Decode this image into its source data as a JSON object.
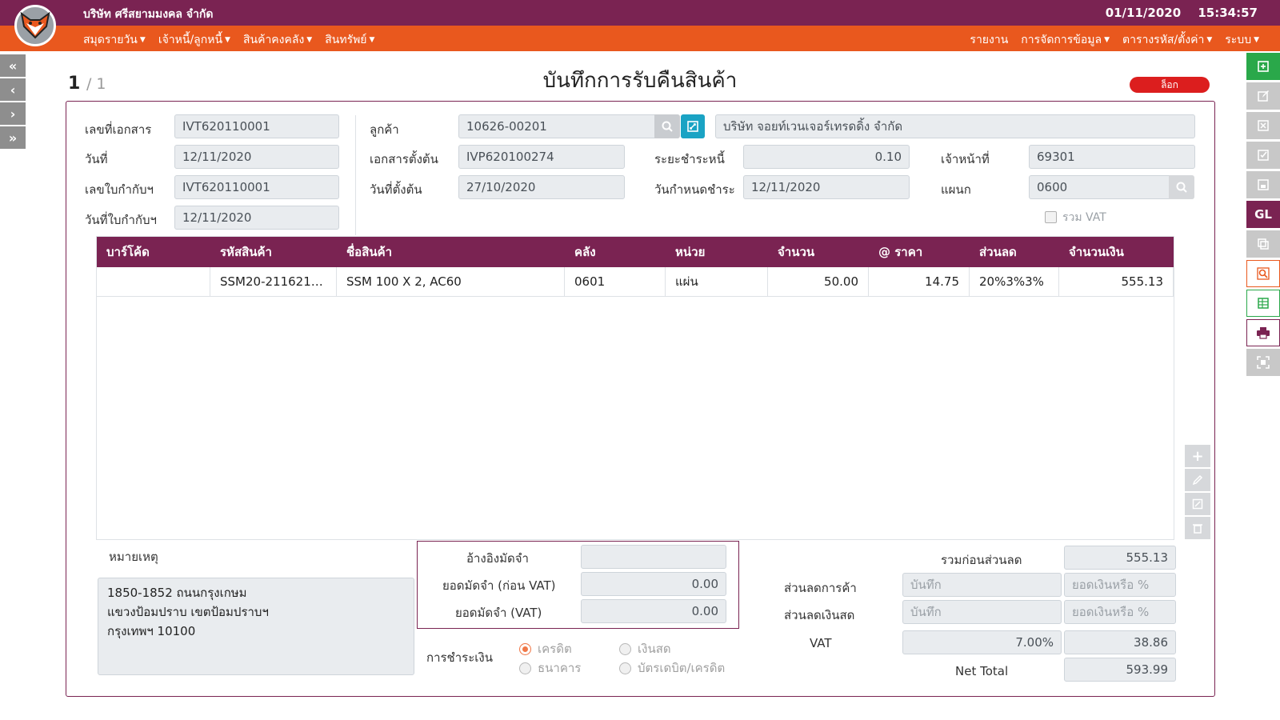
{
  "header": {
    "company": "บริษัท ศรีสยามมงคล จำกัด",
    "date": "01/11/2020",
    "time": "15:34:57"
  },
  "menu": {
    "left": [
      "สมุดรายวัน",
      "เจ้าหนี้/ลูกหนี้",
      "สินค้าคงคลัง",
      "สินทรัพย์"
    ],
    "right_report": "รายงาน",
    "right": [
      "การจัดการข้อมูล",
      "ตารางรหัส/ตั้งค่า",
      "ระบบ"
    ]
  },
  "pager": {
    "current": "1",
    "total": "/ 1"
  },
  "page_title": "บันทึกการรับคืนสินค้า",
  "status_badge": "ล็อก",
  "form": {
    "doc_no_label": "เลขที่เอกสาร",
    "doc_no": "IVT620110001",
    "date_label": "วันที่",
    "date": "12/11/2020",
    "tax_inv_label": "เลขใบกำกับฯ",
    "tax_inv": "IVT620110001",
    "tax_inv_date_label": "วันที่ใบกำกับฯ",
    "tax_inv_date": "12/11/2020",
    "customer_label": "ลูกค้า",
    "customer_code": "10626-00201",
    "customer_name": "บริษัท จอยท์เวนเจอร์เทรดดิ้ง จำกัด",
    "ref_doc_label": "เอกสารตั้งต้น",
    "ref_doc": "IVP620100274",
    "ref_date_label": "วันที่ตั้งต้น",
    "ref_date": "27/10/2020",
    "credit_term_label": "ระยะชำระหนี้",
    "credit_term": "0.10",
    "due_date_label": "วันกำหนดชำระ",
    "due_date": "12/11/2020",
    "officer_label": "เจ้าหน้าที่",
    "officer": "69301",
    "dept_label": "แผนก",
    "dept": "0600",
    "vat_include_label": "รวม VAT"
  },
  "table": {
    "headers": [
      "บาร์โค้ด",
      "รหัสสินค้า",
      "ชื่อสินค้า",
      "คลัง",
      "หน่วย",
      "จำนวน",
      "@ ราคา",
      "ส่วนลด",
      "จำนวนเงิน"
    ],
    "rows": [
      [
        "",
        "SSM20-2116210...",
        "SSM 100 X 2, AC60",
        "0601",
        "แผ่น",
        "50.00",
        "14.75",
        "20%3%3%",
        "555.13"
      ]
    ]
  },
  "remark": {
    "label": "หมายเหตุ",
    "line1": "1850-1852 ถนนกรุงเกษม",
    "line2": "แขวงป้อมปราบ เขตป้อมปราบฯ",
    "line3": "กรุงเทพฯ 10100"
  },
  "deposit": {
    "ref_label": "อ้างอิงมัดจำ",
    "ref_value": "",
    "pre_vat_label": "ยอดมัดจำ (ก่อน VAT)",
    "pre_vat": "0.00",
    "vat_label": "ยอดมัดจำ (VAT)",
    "vat": "0.00"
  },
  "payment": {
    "label": "การชำระเงิน",
    "options": [
      "เครดิต",
      "เงินสด",
      "ธนาคาร",
      "บัตรเดบิต/เครดิต"
    ],
    "selected": "เครดิต"
  },
  "totals": {
    "before_discount_label": "รวมก่อนส่วนลด",
    "before_discount": "555.13",
    "trade_discount_label": "ส่วนลดการค้า",
    "trade_discount_placeholder": "บันทึก",
    "trade_discount_amount_placeholder": "ยอดเงินหรือ %",
    "cash_discount_label": "ส่วนลดเงินสด",
    "cash_discount_placeholder": "บันทึก",
    "cash_discount_amount_placeholder": "ยอดเงินหรือ %",
    "vat_label": "VAT",
    "vat_rate": "7.00%",
    "vat_amount": "38.86",
    "net_total_label": "Net Total",
    "net_total": "593.99"
  },
  "right_toolbar": {
    "gl_label": "GL",
    "colors": [
      "#2aa84a",
      "#c8c8c8",
      "#c8c8c8",
      "#c8c8c8",
      "#c8c8c8",
      "#7a2352",
      "#c8c8c8",
      "#e9581e",
      "#2aa84a",
      "#7a2352",
      "#c8c8c8"
    ]
  }
}
